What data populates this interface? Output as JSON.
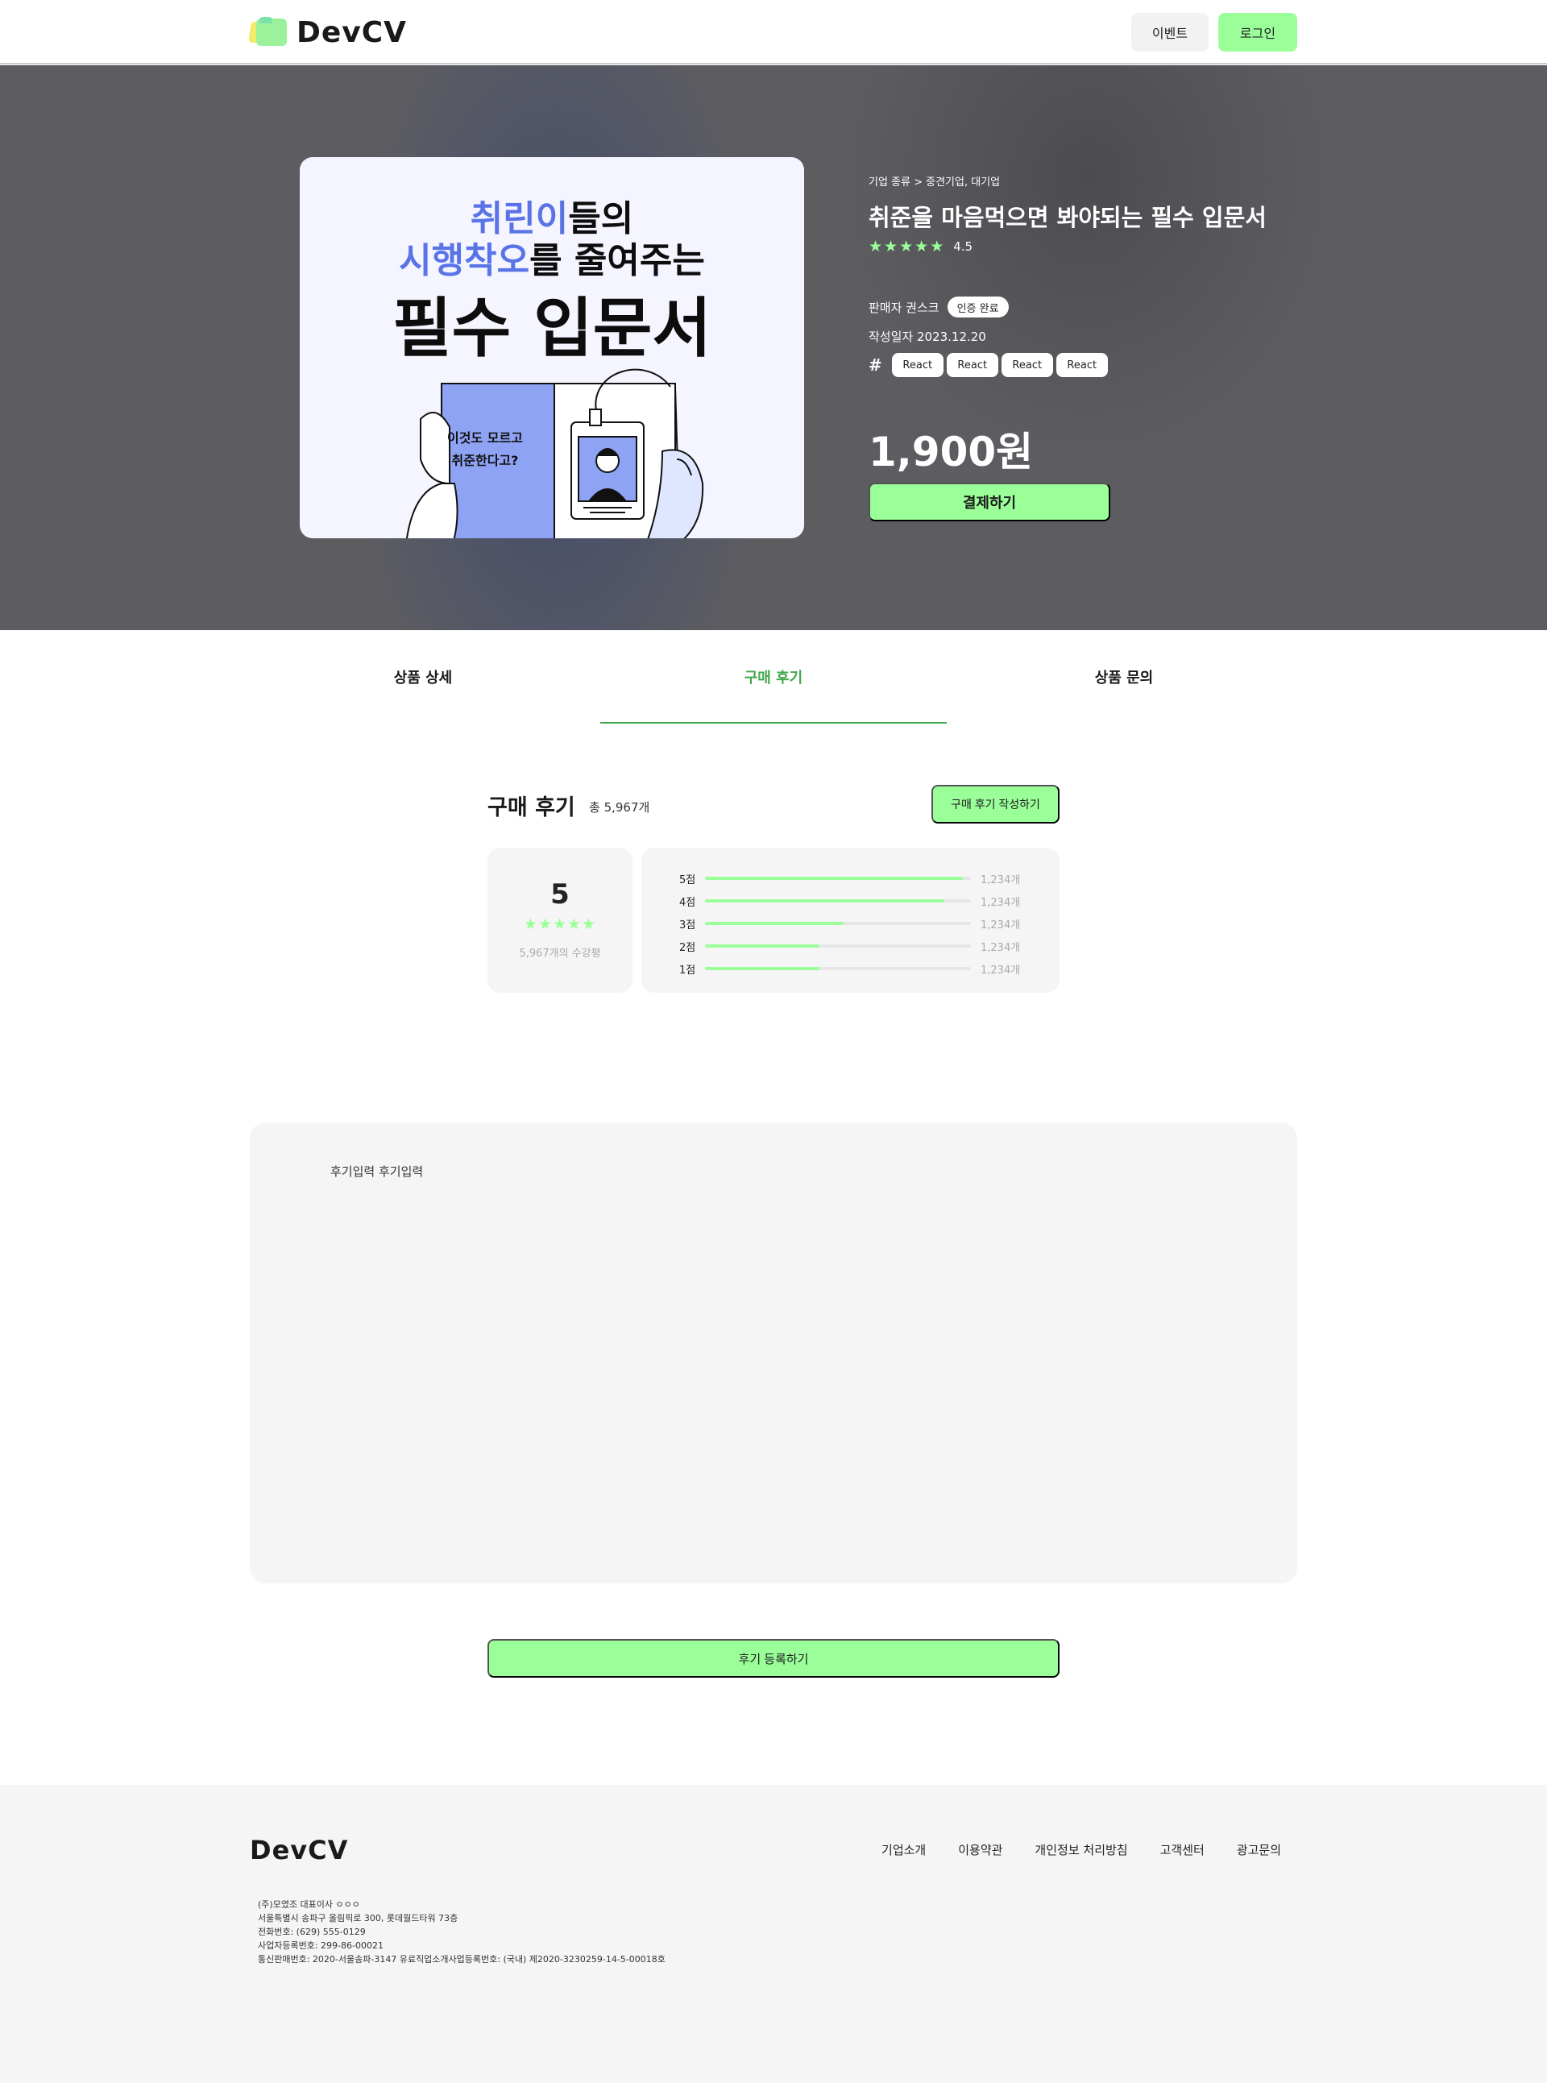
{
  "header": {
    "logo_text": "DevCV",
    "event_button": "이벤트",
    "login_button": "로그인"
  },
  "cover": {
    "line1_highlight": "취린이",
    "line1_rest": "들의",
    "line2_highlight": "시행착오",
    "line2_rest": "를 줄여주는",
    "line3": "필수 입문서",
    "caption_line1": "이것도 모르고",
    "caption_line2": "취준한다고?"
  },
  "product": {
    "category": "기업 종류 > 중견기업, 대기업",
    "title": "취준을 마음먹으면 봐야되는 필수 입문서",
    "rating": "4.5",
    "rating_stars": 5,
    "seller": "판매자 권스크",
    "seller_badge": "인증 완료",
    "date": "작성일자 2023.12.20",
    "hash_symbol": "#",
    "tags": [
      "React",
      "React",
      "React",
      "React"
    ],
    "price": "1,900원",
    "pay_button": "결제하기"
  },
  "tabs": {
    "detail": "상품 상세",
    "reviews": "구매 후기",
    "inquiry": "상품 문의",
    "active": "구매 후기"
  },
  "reviews": {
    "title": "구매 후기",
    "total": "총 5,967개",
    "write_button": "구매 후기 작성하기",
    "score": "5",
    "score_stars": "★★★★★",
    "score_count": "5,967개의 수강평",
    "distribution": [
      {
        "label": "5점",
        "fraction": 0.97,
        "count": "1,234개"
      },
      {
        "label": "4점",
        "fraction": 0.9,
        "count": "1,234개"
      },
      {
        "label": "3점",
        "fraction": 0.52,
        "count": "1,234개"
      },
      {
        "label": "2점",
        "fraction": 0.43,
        "count": "1,234개"
      },
      {
        "label": "1점",
        "fraction": 0.43,
        "count": "1,234개"
      }
    ],
    "input_text": "후기입력 후기입력",
    "submit_button": "후기 등록하기"
  },
  "footer": {
    "logo_text": "DevCV",
    "links": [
      "기업소개",
      "이용약관",
      "개인정보 처리방침",
      "고객센터",
      "광고문의"
    ],
    "info_lines": [
      "(주)모였조   대표이사 ㅇㅇㅇ",
      "서울특별시 송파구 올림픽로 300, 롯데월드타워 73층",
      "전화번호: (629) 555-0129",
      "사업자등록번호: 299-86-00021",
      "통신판매번호: 2020-서울송파-3147  유료직업소개사업등록번호: (국내) 제2020-3230259-14-5-00018호"
    ]
  },
  "colors": {
    "accent": "#9bff99",
    "active_tab": "#41a84d",
    "cover_blue": "#5a74e8",
    "hero_bg": "#5d5d61"
  }
}
